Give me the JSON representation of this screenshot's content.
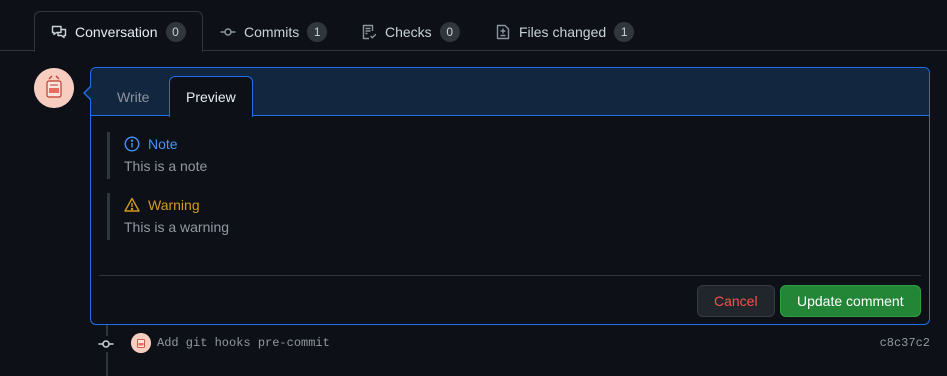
{
  "tabs": [
    {
      "label": "Conversation",
      "count": "0",
      "icon": "comment-discussion-icon",
      "active": true
    },
    {
      "label": "Commits",
      "count": "1",
      "icon": "git-commit-icon",
      "active": false
    },
    {
      "label": "Checks",
      "count": "0",
      "icon": "checklist-icon",
      "active": false
    },
    {
      "label": "Files changed",
      "count": "1",
      "icon": "file-diff-icon",
      "active": false
    }
  ],
  "editor": {
    "write_label": "Write",
    "preview_label": "Preview",
    "active_tab": "Preview",
    "alerts": [
      {
        "type": "note",
        "title": "Note",
        "text": "This is a note",
        "icon": "info-icon",
        "color": "#4493f8"
      },
      {
        "type": "warning",
        "title": "Warning",
        "text": "This is a warning",
        "icon": "alert-icon",
        "color": "#d29922"
      }
    ],
    "cancel_label": "Cancel",
    "update_label": "Update comment"
  },
  "commit": {
    "message": "Add git hooks pre-commit",
    "sha": "c8c37c2",
    "icon": "git-commit-icon"
  },
  "colors": {
    "background": "#0d1117",
    "accent": "#1f6feb",
    "primary_button": "#238636",
    "danger_text": "#f85149"
  }
}
